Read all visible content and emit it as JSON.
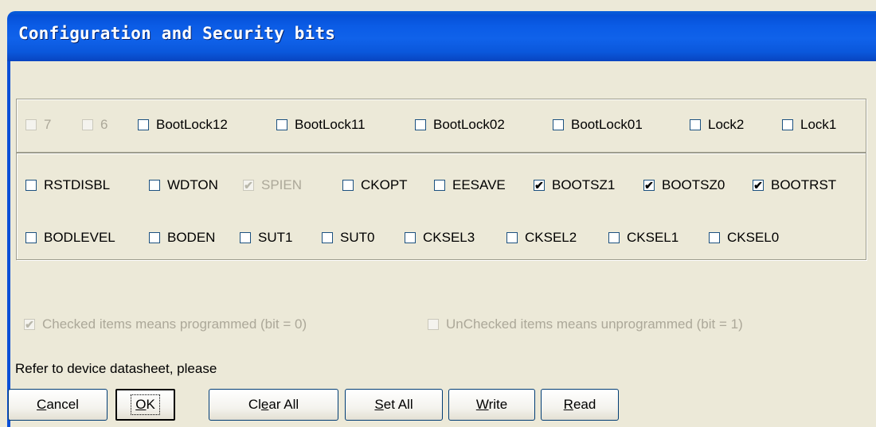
{
  "window": {
    "title": "Configuration and Security bits"
  },
  "lock_bits": [
    {
      "label": "7",
      "checked": false,
      "disabled": true
    },
    {
      "label": "6",
      "checked": false,
      "disabled": true
    },
    {
      "label": "BootLock12",
      "checked": false,
      "disabled": false
    },
    {
      "label": "BootLock11",
      "checked": false,
      "disabled": false
    },
    {
      "label": "BootLock02",
      "checked": false,
      "disabled": false
    },
    {
      "label": "BootLock01",
      "checked": false,
      "disabled": false
    },
    {
      "label": "Lock2",
      "checked": false,
      "disabled": false
    },
    {
      "label": "Lock1",
      "checked": false,
      "disabled": false
    }
  ],
  "fuse_row1": [
    {
      "label": "RSTDISBL",
      "checked": false,
      "disabled": false
    },
    {
      "label": "WDTON",
      "checked": false,
      "disabled": false
    },
    {
      "label": "SPIEN",
      "checked": true,
      "disabled": true
    },
    {
      "label": "CKOPT",
      "checked": false,
      "disabled": false
    },
    {
      "label": "EESAVE",
      "checked": false,
      "disabled": false
    },
    {
      "label": "BOOTSZ1",
      "checked": true,
      "disabled": false
    },
    {
      "label": "BOOTSZ0",
      "checked": true,
      "disabled": false
    },
    {
      "label": "BOOTRST",
      "checked": true,
      "disabled": false
    }
  ],
  "fuse_row2": [
    {
      "label": "BODLEVEL",
      "checked": false,
      "disabled": false
    },
    {
      "label": "BODEN",
      "checked": false,
      "disabled": false
    },
    {
      "label": "SUT1",
      "checked": false,
      "disabled": false
    },
    {
      "label": "SUT0",
      "checked": false,
      "disabled": false
    },
    {
      "label": "CKSEL3",
      "checked": false,
      "disabled": false
    },
    {
      "label": "CKSEL2",
      "checked": false,
      "disabled": false
    },
    {
      "label": "CKSEL1",
      "checked": false,
      "disabled": false
    },
    {
      "label": "CKSEL0",
      "checked": false,
      "disabled": false
    }
  ],
  "legend": {
    "checked_note": "Checked items means programmed (bit = 0)",
    "checked_note_state": true,
    "unchecked_note": "UnChecked items means unprogrammed (bit = 1)",
    "unchecked_note_state": false
  },
  "hint": "Refer to device datasheet, please",
  "buttons": [
    {
      "label": "Cancel",
      "mnemonic": "C"
    },
    {
      "label": "OK",
      "mnemonic": "O",
      "default": true
    },
    {
      "label": "Clear All",
      "mnemonic": "e"
    },
    {
      "label": "Set All",
      "mnemonic": "S"
    },
    {
      "label": "Write",
      "mnemonic": "W"
    },
    {
      "label": "Read",
      "mnemonic": "R"
    }
  ],
  "colors": {
    "dialog_bg": "#ECE9D8",
    "title_bar": "#0A5AE0",
    "disabled_text": "#ACA899",
    "checkbox_border": "#1C5180"
  },
  "icons": {
    "check": "check-mark-icon"
  }
}
